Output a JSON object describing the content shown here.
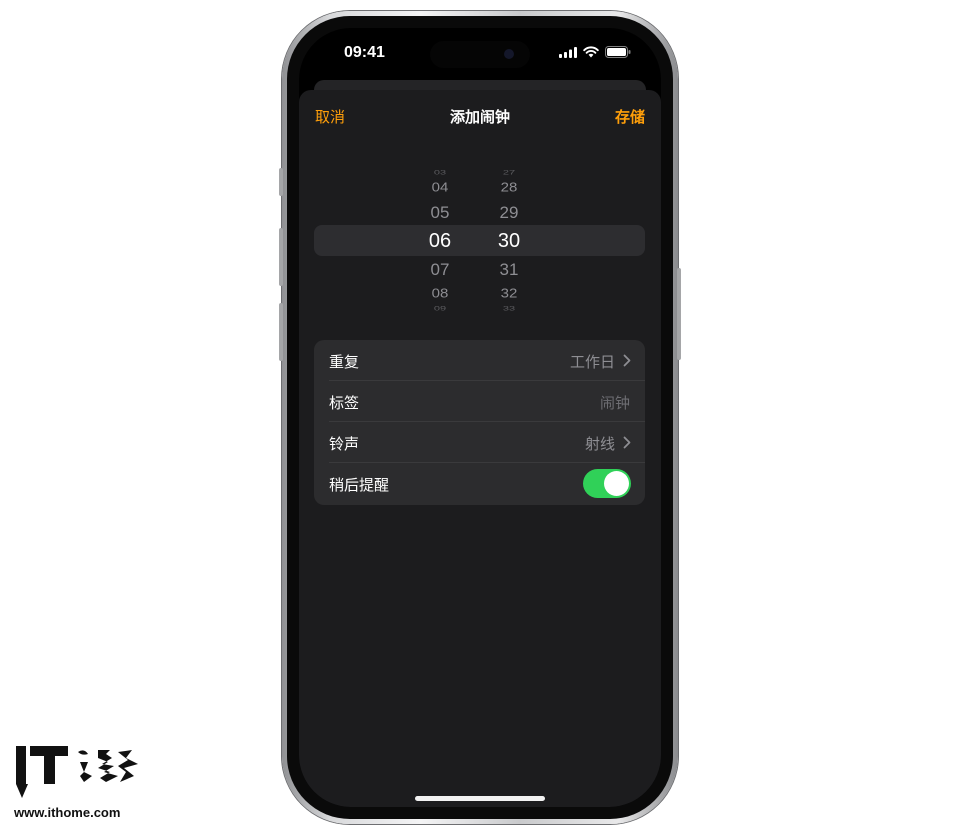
{
  "status_bar": {
    "time": "09:41",
    "icons": [
      "cellular-signal-icon",
      "wifi-icon",
      "battery-icon"
    ]
  },
  "nav": {
    "cancel_label": "取消",
    "title": "添加闹钟",
    "save_label": "存储"
  },
  "time_picker": {
    "hours": [
      "03",
      "04",
      "05",
      "06",
      "07",
      "08",
      "09"
    ],
    "minutes": [
      "27",
      "28",
      "29",
      "30",
      "31",
      "32",
      "33"
    ],
    "selected_hour": "06",
    "selected_minute": "30"
  },
  "settings": {
    "repeat": {
      "label": "重复",
      "value": "工作日"
    },
    "label": {
      "label": "标签",
      "placeholder": "闹钟"
    },
    "sound": {
      "label": "铃声",
      "value": "射线"
    },
    "snooze": {
      "label": "稍后提醒",
      "enabled": true
    }
  },
  "colors": {
    "accent": "#ff9f0a",
    "toggle_on": "#30d158",
    "sheet_background": "#1c1c1e",
    "group_background": "#2c2c2e"
  },
  "watermark": {
    "logo_text": "IT之家",
    "url": "www.ithome.com"
  }
}
